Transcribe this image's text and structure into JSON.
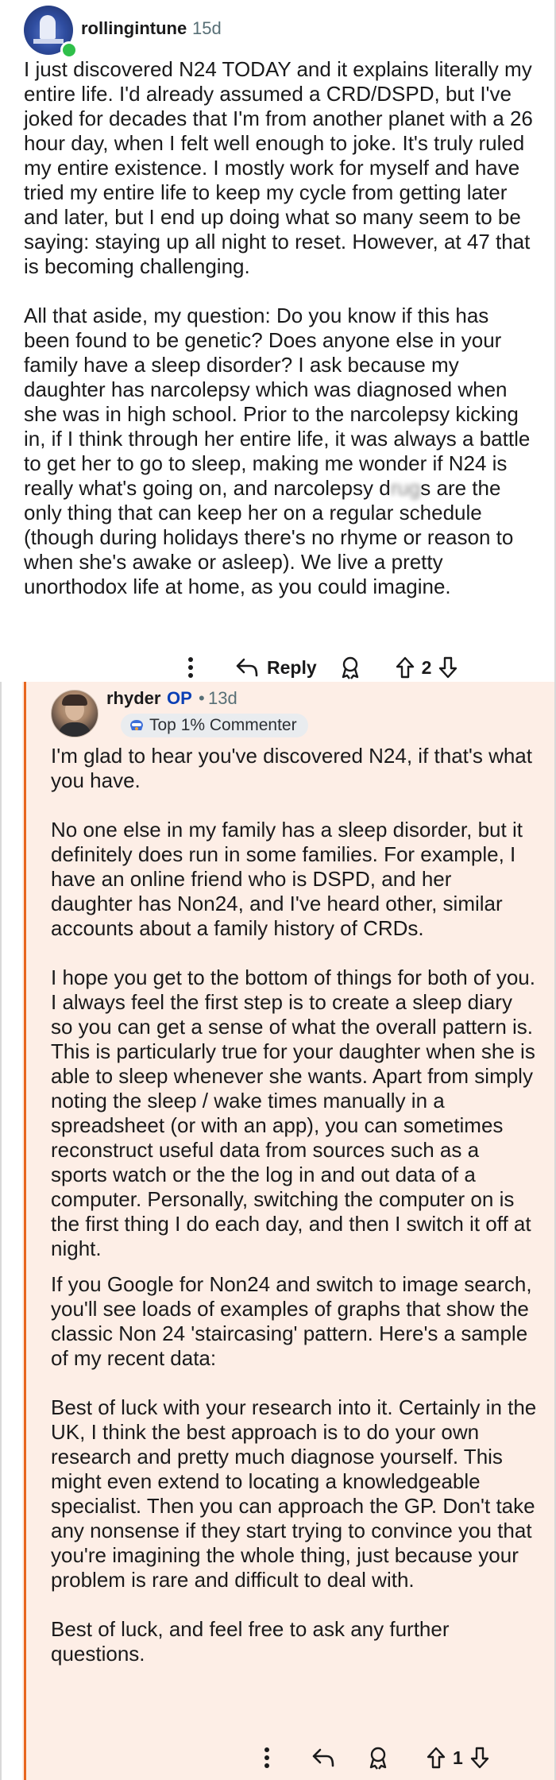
{
  "top_comment": {
    "username": "rollingintune",
    "time": "15d",
    "paragraphs": [
      "I just discovered N24 TODAY and it explains literally my entire life. I'd already assumed a CRD/DSPD, but I've joked for decades that I'm from another planet with a 26 hour day, when I felt well enough to joke. It's truly ruled my entire existence. I mostly work for myself and have tried my entire life to keep my cycle from getting later and later, but I end up doing what so many seem to be saying: staying up all night to reset. However, at 47 that is becoming challenging."
    ],
    "p2_before": "All that aside, my question: Do you know if this has been found to be genetic? Does anyone else in your family have a sleep disorder? I ask because my daughter has narcolepsy which was diagnosed when she was in high school. Prior to the narcolepsy kicking in, if I think through her entire life, it was always a battle to get her to go to sleep, making me wonder if N24 is really what's going on, and narcolepsy d",
    "p2_blurred": "rug",
    "p2_after": "s are the only thing that can keep her on a regular schedule (though during holidays there's no rhyme or reason to when she's awake or asleep). We live a pretty unorthodox life at home, as you could imagine.",
    "actions": {
      "reply_label": "Reply",
      "vote_count": "2"
    }
  },
  "reply": {
    "username": "rhyder",
    "op_tag": "OP",
    "separator": "•",
    "time": "13d",
    "badge": "Top 1% Commenter",
    "paragraphs": [
      "I'm glad to hear you've discovered N24, if that's what you have.",
      "No one else in my family has a sleep disorder, but it definitely does run in some families. For example, I have an online friend who is DSPD, and her daughter has Non24, and I've heard other, similar accounts about a family history of CRDs.",
      "I hope you get to the bottom of things for both of you. I always feel the first step is to create a sleep diary so you can get a sense of what the overall pattern is. This is particularly true for your daughter when she is able to sleep whenever she wants. Apart from simply noting the sleep / wake times manually in a spreadsheet (or with an app), you can sometimes reconstruct useful data from sources such as a sports watch or the the log in and out data of a computer. Personally, switching the computer on is the first thing I do each day, and then I switch it off at night.",
      "If you Google for Non24 and switch to image search, you'll see loads of examples of graphs that show the classic Non 24 'staircasing' pattern. Here's a sample of my recent data:",
      "Best of luck with your research into it. Certainly in the UK, I think the best approach is to do your own research and pretty much diagnose yourself. This might even extend to locating a knowledgeable specialist. Then you can approach the GP. Don't take any nonsense if they start trying to convince you that you're imagining the whole thing, just because your problem is rare and difficult to deal with.",
      "Best of luck, and feel free to ask any further questions."
    ],
    "actions": {
      "vote_count": "1"
    }
  },
  "icons": [
    "more-options-icon",
    "reply-arrow-icon",
    "award-icon",
    "upvote-icon",
    "downvote-icon",
    "commenter-badge-icon",
    "online-status-dot"
  ],
  "colors": {
    "thread_line": "#e8661f",
    "reply_background": "#fdeee6",
    "op_tag": "#0a3fb5",
    "online_dot": "#2fbf4a"
  }
}
